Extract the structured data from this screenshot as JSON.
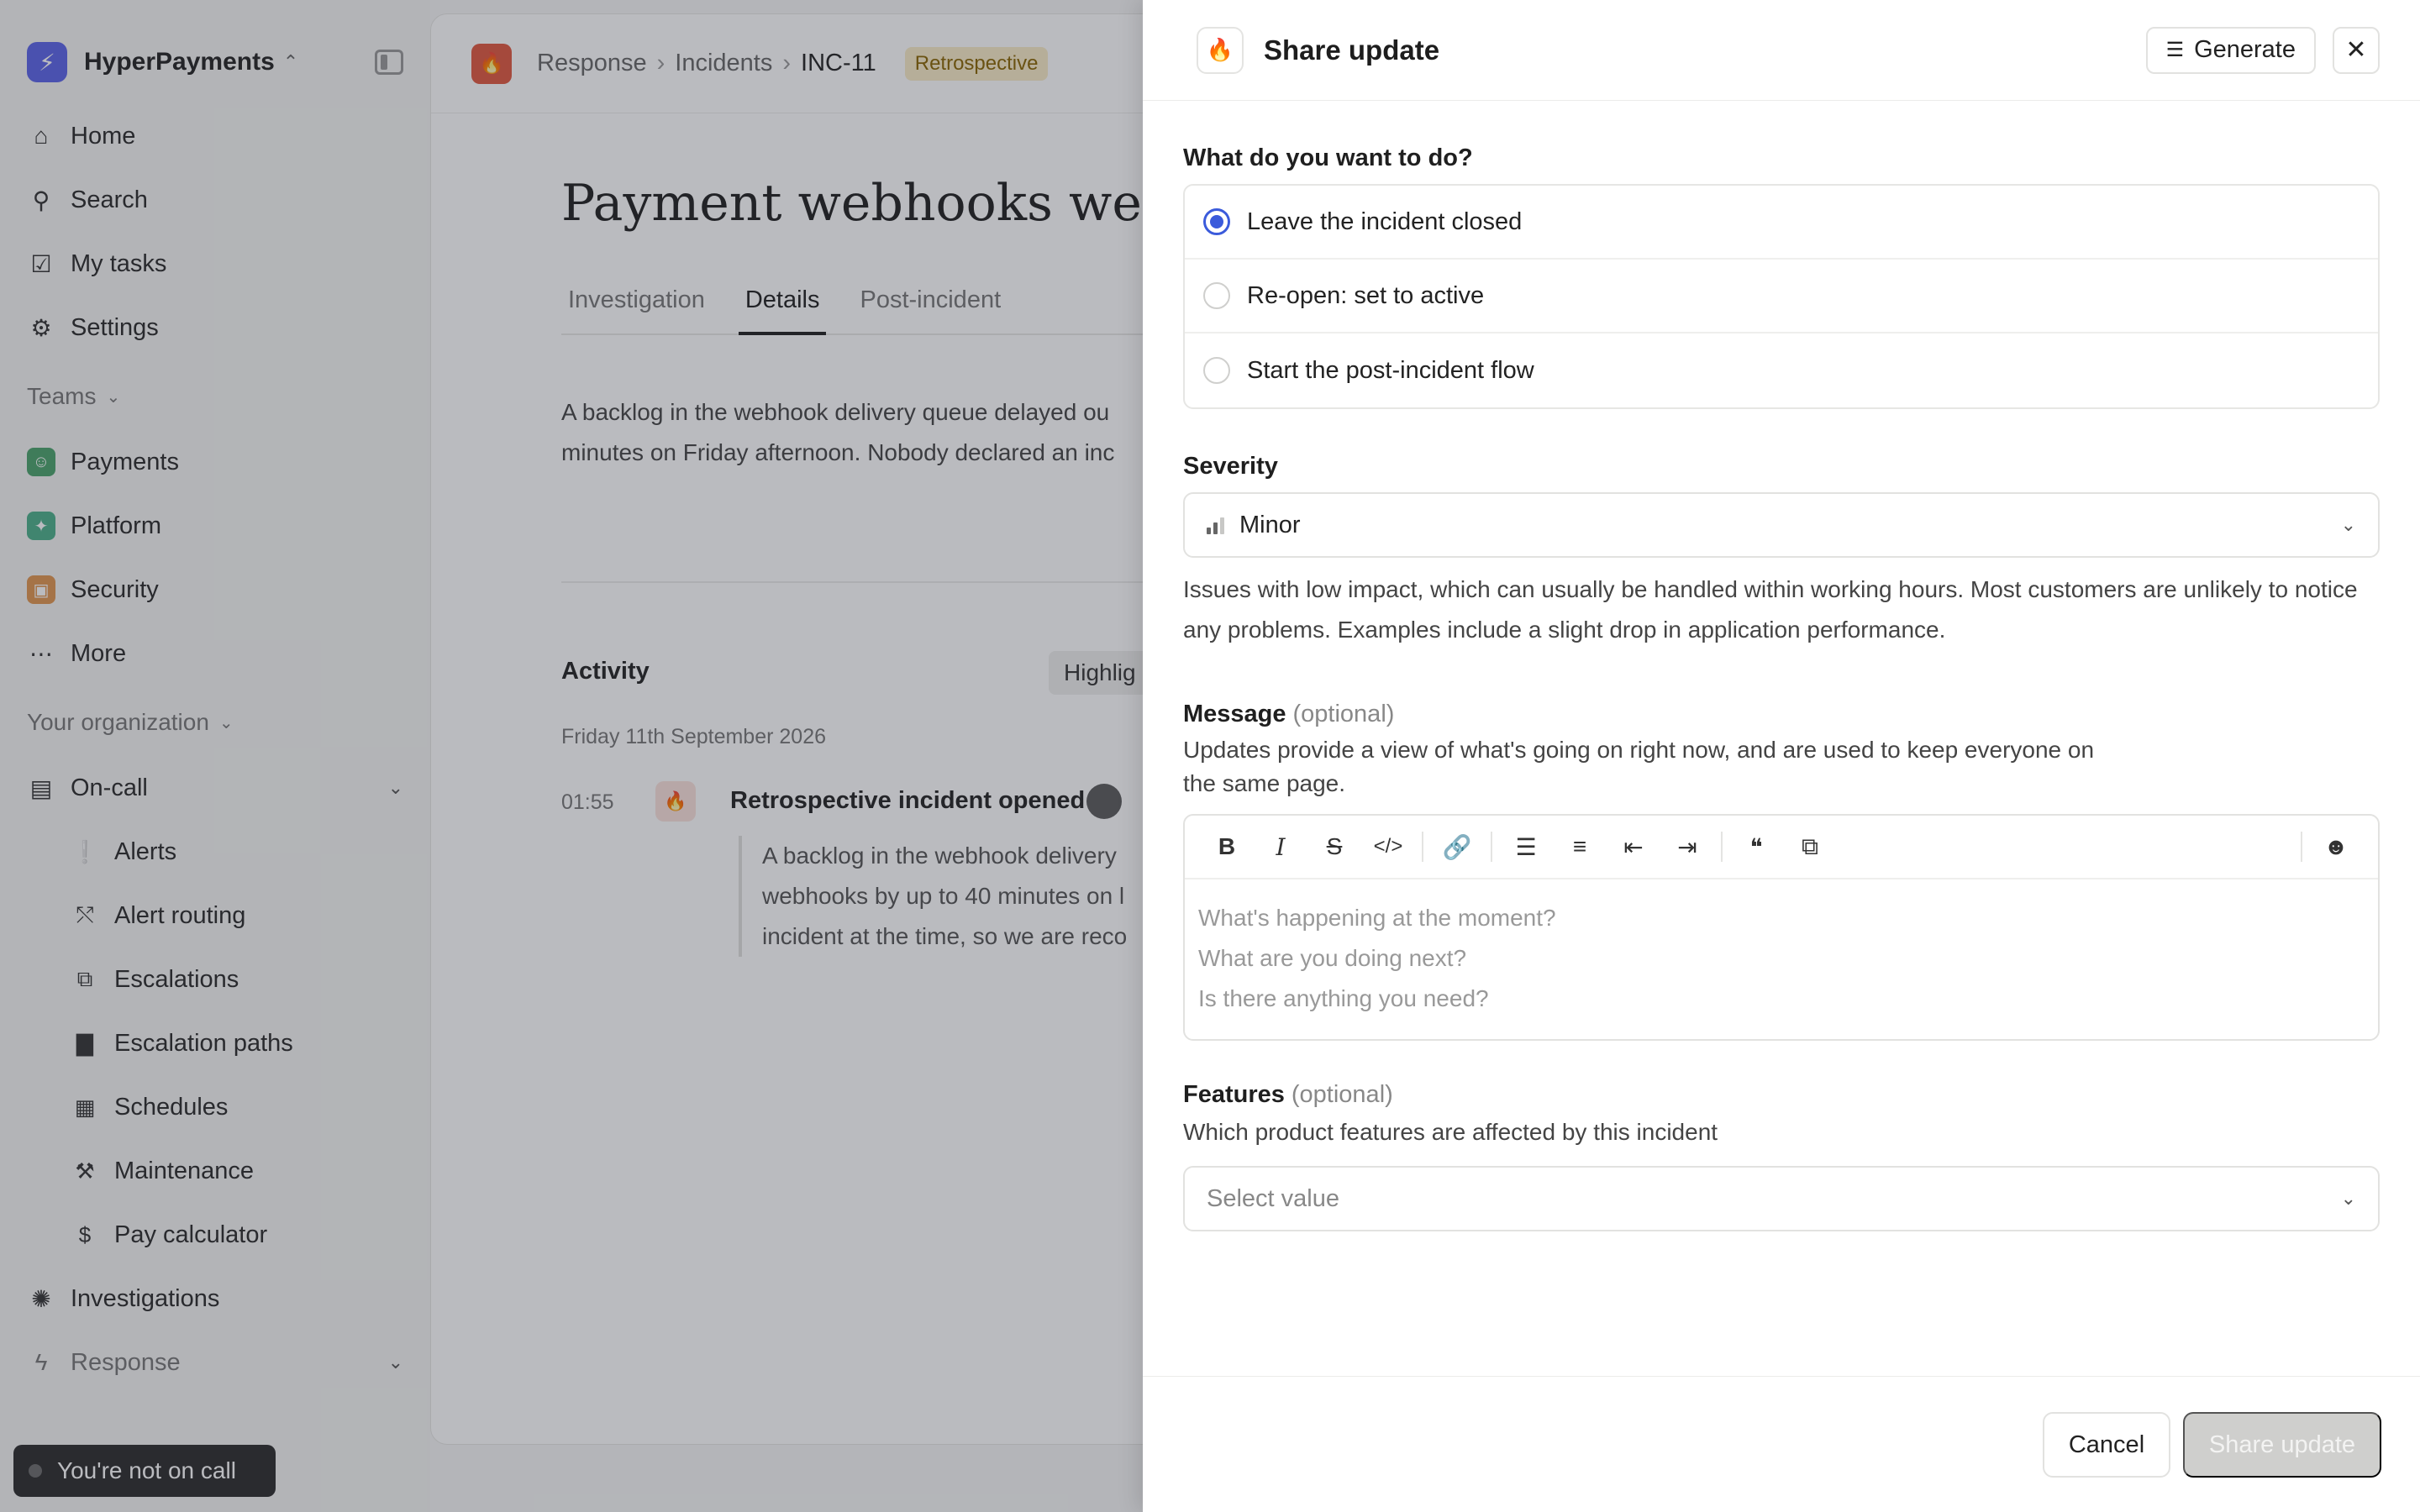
{
  "sidebar": {
    "org_name": "HyperPayments",
    "nav": [
      {
        "label": "Home",
        "icon": "home-icon"
      },
      {
        "label": "Search",
        "icon": "search-icon"
      },
      {
        "label": "My tasks",
        "icon": "tasks-icon"
      },
      {
        "label": "Settings",
        "icon": "gear-icon"
      }
    ],
    "teams_label": "Teams",
    "teams": [
      {
        "label": "Payments",
        "color": "#4aa36b"
      },
      {
        "label": "Platform",
        "color": "#4cb08a"
      },
      {
        "label": "Security",
        "color": "#e0954e"
      }
    ],
    "more_label": "More",
    "org_section_label": "Your organization",
    "oncall_label": "On-call",
    "oncall_items": [
      {
        "label": "Alerts",
        "icon": "alert-icon"
      },
      {
        "label": "Alert routing",
        "icon": "routing-icon"
      },
      {
        "label": "Escalations",
        "icon": "escalation-icon"
      },
      {
        "label": "Escalation paths",
        "icon": "book-icon"
      },
      {
        "label": "Schedules",
        "icon": "calendar-icon"
      },
      {
        "label": "Maintenance",
        "icon": "hammer-icon"
      },
      {
        "label": "Pay calculator",
        "icon": "dollar-icon"
      }
    ],
    "investigations_label": "Investigations",
    "response_label": "Response",
    "not_on_call": "You're not on call"
  },
  "main": {
    "breadcrumb": [
      "Response",
      "Incidents",
      "INC-11"
    ],
    "status_badge": "Retrospective",
    "title": "Payment webhooks were",
    "tabs": [
      "Investigation",
      "Details",
      "Post-incident"
    ],
    "summary_line1": "A backlog in the webhook delivery queue delayed ou",
    "summary_line2": "minutes on Friday afternoon. Nobody declared an inc",
    "activity_title": "Activity",
    "highlight_label": "Highlig",
    "activity_date": "Friday 11th September 2026",
    "activity_time": "01:55",
    "activity_event": "Retrospective incident opened",
    "activity_quote_lines": [
      "A backlog in the webhook delivery",
      "webhooks by up to 40 minutes on l",
      "incident at the time, so we are reco"
    ]
  },
  "drawer": {
    "title": "Share update",
    "generate_label": "Generate",
    "question": "What do you want to do?",
    "options": [
      {
        "label": "Leave the incident closed",
        "checked": true
      },
      {
        "label": "Re-open: set to active",
        "checked": false
      },
      {
        "label": "Start the post-incident flow",
        "checked": false
      }
    ],
    "severity_label": "Severity",
    "severity_value": "Minor",
    "severity_help": "Issues with low impact, which can usually be handled within working hours. Most customers are unlikely to notice any problems. Examples include a slight drop in application performance.",
    "message_label": "Message",
    "optional": "(optional)",
    "message_help_line1": "Updates provide a view of what's going on right now, and are used to keep everyone on",
    "message_help_line2": "the same page.",
    "message_placeholders": [
      "What's happening at the moment?",
      "What are you doing next?",
      "Is there anything you need?"
    ],
    "features_label": "Features",
    "features_help": "Which product features are affected by this incident",
    "features_placeholder": "Select value",
    "cancel_label": "Cancel",
    "share_label": "Share update"
  }
}
